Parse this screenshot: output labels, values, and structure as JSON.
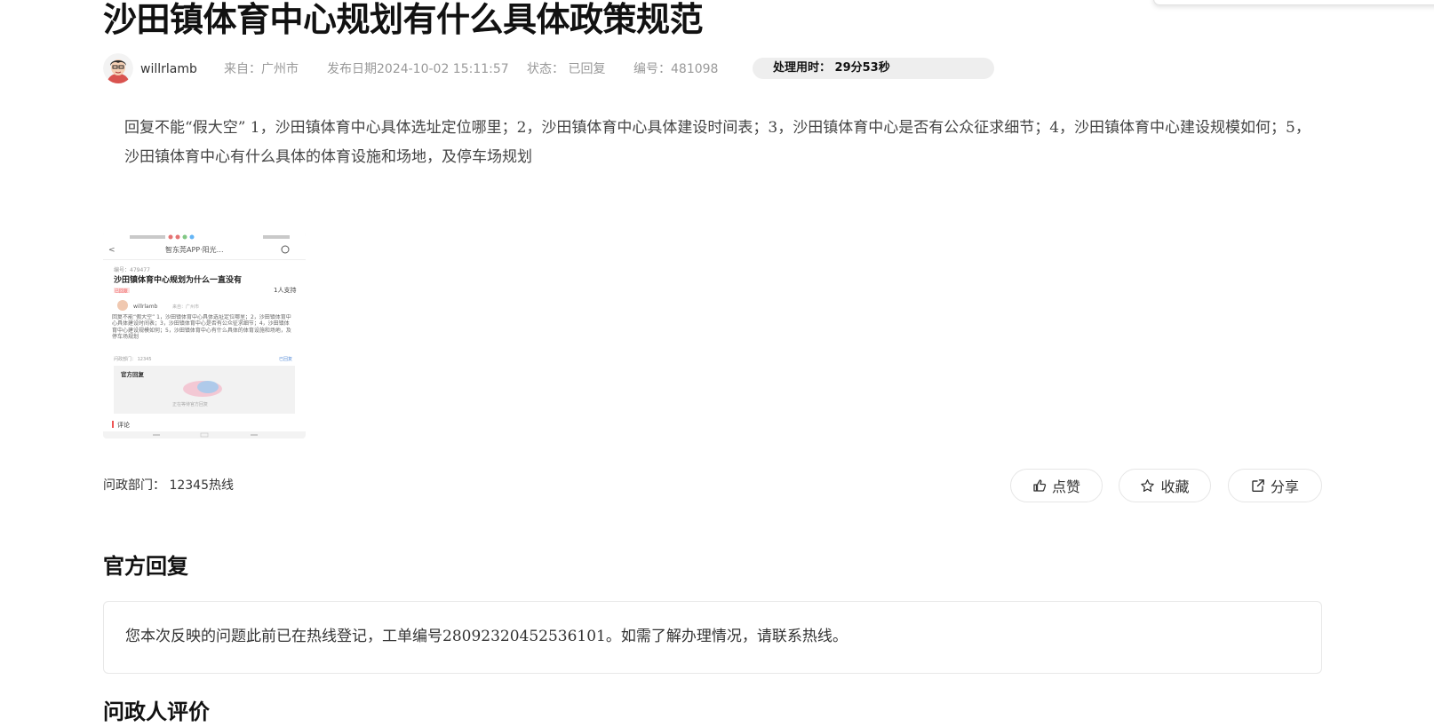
{
  "article": {
    "title": "沙田镇体育中心规划有什么具体政策规范",
    "author": "willrlamb",
    "from": "来自：广州市",
    "publish_date": "发布日期2024-10-02 15:11:57",
    "status": "状态：  已回复",
    "number": "编号：481098",
    "processing_time": "处理用时：  29分53秒",
    "content": "回复不能“假大空” 1，沙田镇体育中心具体选址定位哪里；2，沙田镇体育中心具体建设时间表；3，沙田镇体育中心是否有公众征求细节；4，沙田镇体育中心建设规模如何；5，沙田镇体育中心有什么具体的体育设施和场地，及停车场规划",
    "department": "问政部门：  12345热线"
  },
  "actions": {
    "like_label": "点赞",
    "favorite_label": "收藏",
    "share_label": "分享"
  },
  "official_reply": {
    "heading": "官方回复",
    "text": "您本次反映的问题此前已在热线登记，工单编号28092320452536101。如需了解办理情况，请联系热线。"
  },
  "next_section": {
    "heading": "问政人评价"
  },
  "thumbnail": {
    "app_title": "智东莞APP·阳光…",
    "post_number": "编号：479477",
    "post_title": "沙田镇体育中心规划为什么一直没有",
    "support_count": "1人支持",
    "status_badge": "已回复",
    "author": "willrlamb",
    "from": "来自：广州市",
    "body": "回复不能“假大空” 1，沙田镇体育中心具体选址定位哪里；2，沙田镇体育中心具体建设时间表；3，沙田镇体育中心是否有公众征求细节；4，沙田镇体育中心建设规模如何；5，沙田镇体育中心有什么具体的体育设施和场地，及停车场规划",
    "dept": "问政部门：  12345",
    "official_reply": "官方回复",
    "reply_placeholder": "正在等待官方回复",
    "comments": "评论"
  }
}
